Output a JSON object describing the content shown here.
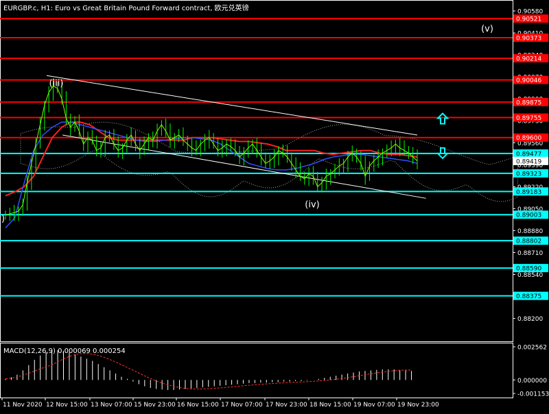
{
  "window": {
    "title": "EURGBP.c, H1:  Euro vs Great Britain Pound Forward contract, 欧元兑英镑"
  },
  "colors": {
    "background": "#000000",
    "candle": "#00ff00",
    "line_candle": "#7fff00",
    "resistance": "#ff0000",
    "support": "#00ffff",
    "text": "#ffffff",
    "ma_red": "#ff2020",
    "ma_blue": "#3050ff",
    "ma_green": "#00a000",
    "macd_hist": "#ffffff",
    "macd_signal": "#ff3030"
  },
  "icons": [
    "up-arrow-icon",
    "down-arrow-icon"
  ],
  "chart_data": {
    "type": "line",
    "instrument": "EURGBP.c",
    "timeframe": "H1",
    "ylim": [
      0.88182,
      0.9058
    ],
    "y_ticks": [
      0.9058,
      0.9041,
      0.9024,
      0.9007,
      0.899,
      0.8973,
      0.8956,
      0.8939,
      0.8922,
      0.8905,
      0.8888,
      0.8871,
      0.8854,
      0.8837,
      0.882
    ],
    "x_labels": [
      "11 Nov 2020",
      "12 Nov 15:00",
      "13 Nov 07:00",
      "15 Nov 23:00",
      "16 Nov 15:00",
      "17 Nov 07:00",
      "17 Nov 23:00",
      "18 Nov 15:00",
      "19 Nov 07:00",
      "19 Nov 23:00"
    ],
    "horizontal_levels": [
      {
        "value": 0.90521,
        "kind": "resistance"
      },
      {
        "value": 0.90373,
        "kind": "resistance"
      },
      {
        "value": 0.90214,
        "kind": "resistance"
      },
      {
        "value": 0.90046,
        "kind": "resistance"
      },
      {
        "value": 0.89875,
        "kind": "resistance"
      },
      {
        "value": 0.89755,
        "kind": "resistance"
      },
      {
        "value": 0.896,
        "kind": "resistance"
      },
      {
        "value": 0.89477,
        "kind": "support"
      },
      {
        "value": 0.89323,
        "kind": "support"
      },
      {
        "value": 0.89183,
        "kind": "support"
      },
      {
        "value": 0.89003,
        "kind": "support"
      },
      {
        "value": 0.88802,
        "kind": "support"
      },
      {
        "value": 0.8859,
        "kind": "support"
      },
      {
        "value": 0.88375,
        "kind": "support"
      }
    ],
    "current_price": 0.89419,
    "wave_labels": [
      "(iii)",
      "(iv)",
      "(v)",
      ")"
    ],
    "trend_channel": {
      "upper": [
        [
          0,
          0.9008
        ],
        [
          95,
          0.8962
        ]
      ],
      "lower": [
        [
          10,
          0.8962
        ],
        [
          97,
          0.8913
        ]
      ]
    },
    "price_series": [
      0.89,
      0.8901,
      0.8902,
      0.8903,
      0.8908,
      0.8925,
      0.894,
      0.8955,
      0.897,
      0.8985,
      0.8995,
      0.9,
      0.8998,
      0.899,
      0.8975,
      0.8968,
      0.8972,
      0.8965,
      0.8955,
      0.896,
      0.8958,
      0.895,
      0.8952,
      0.896,
      0.8962,
      0.8955,
      0.895,
      0.8952,
      0.8958,
      0.8962,
      0.8955,
      0.895,
      0.8955,
      0.896,
      0.8958,
      0.8965,
      0.897,
      0.8965,
      0.8958,
      0.896,
      0.8962,
      0.8958,
      0.8955,
      0.8952,
      0.895,
      0.8955,
      0.8958,
      0.896,
      0.8955,
      0.895,
      0.8952,
      0.8955,
      0.8953,
      0.895,
      0.8945,
      0.8948,
      0.8952,
      0.8955,
      0.895,
      0.8945,
      0.894,
      0.8942,
      0.8945,
      0.895,
      0.8948,
      0.8945,
      0.894,
      0.8935,
      0.893,
      0.8928,
      0.8932,
      0.893,
      0.8922,
      0.8925,
      0.893,
      0.8932,
      0.8935,
      0.8938,
      0.894,
      0.8945,
      0.8948,
      0.8945,
      0.894,
      0.893,
      0.8938,
      0.8942,
      0.8945,
      0.8948,
      0.895,
      0.8952,
      0.8955,
      0.8952,
      0.895,
      0.8948,
      0.8945,
      0.8942
    ],
    "moving_averages": [
      {
        "color": "red",
        "values": [
          0.8915,
          0.8918,
          0.8922,
          0.893,
          0.8945,
          0.896,
          0.8968,
          0.8972,
          0.8972,
          0.897,
          0.8965,
          0.896,
          0.8958,
          0.8958,
          0.8958,
          0.8958,
          0.8958,
          0.8958,
          0.8958,
          0.8958,
          0.896,
          0.896,
          0.896,
          0.8959,
          0.8958,
          0.8957,
          0.8957,
          0.8956,
          0.8955,
          0.8953,
          0.895,
          0.895,
          0.895,
          0.895,
          0.8948,
          0.8947,
          0.8948,
          0.8949,
          0.895,
          0.895,
          0.8948,
          0.8947,
          0.8947,
          0.8946,
          0.8945
        ]
      },
      {
        "color": "blue",
        "values": [
          0.889,
          0.8898,
          0.8925,
          0.895,
          0.8962,
          0.8968,
          0.8972,
          0.8972,
          0.897,
          0.8968,
          0.8966,
          0.8964,
          0.8962,
          0.896,
          0.8958,
          0.8957,
          0.8957,
          0.8958,
          0.8959,
          0.896,
          0.896,
          0.8959,
          0.8958,
          0.8955,
          0.895,
          0.8945,
          0.894,
          0.8938,
          0.8936,
          0.8935,
          0.8935,
          0.8936,
          0.8938,
          0.894,
          0.8943,
          0.8945,
          0.8946,
          0.8947,
          0.8947,
          0.8946,
          0.8945,
          0.8944,
          0.8943,
          0.8942,
          0.894
        ]
      }
    ],
    "macd": {
      "label": "MACD(12,26,9) 0.000069 0.000254",
      "ylim": [
        -0.00028,
        0.00065
      ],
      "y_ticks": [
        0.002562,
        0.0,
        -0.001153
      ],
      "histogram": [
        2e-05,
        5e-05,
        0.0001,
        0.00018,
        0.00028,
        0.00038,
        0.00046,
        0.00052,
        0.00055,
        0.00056,
        0.00055,
        0.00052,
        0.00048,
        0.00044,
        0.0004,
        0.00036,
        0.0003,
        0.00024,
        0.00018,
        0.00012,
        6e-05,
        2e-05,
        -3e-05,
        -8e-05,
        -0.00012,
        -0.00015,
        -0.00017,
        -0.00018,
        -0.00019,
        -0.00019,
        -0.00018,
        -0.00017,
        -0.00016,
        -0.00015,
        -0.00014,
        -0.00013,
        -0.00012,
        -0.00011,
        -0.0001,
        -9e-05,
        -8e-05,
        -7e-05,
        -6e-05,
        -6e-05,
        -5e-05,
        -5e-05,
        -4e-05,
        -4e-05,
        -3e-05,
        -3e-05,
        -2e-05,
        -2e-05,
        -1e-05,
        0.0,
        2e-05,
        4e-05,
        6e-05,
        8e-05,
        0.0001,
        0.00012,
        0.00014,
        0.00016,
        0.00017,
        0.00018,
        0.00019,
        0.0002,
        0.0002,
        0.0002,
        0.00019,
        0.00018,
        0.00017
      ]
    }
  }
}
